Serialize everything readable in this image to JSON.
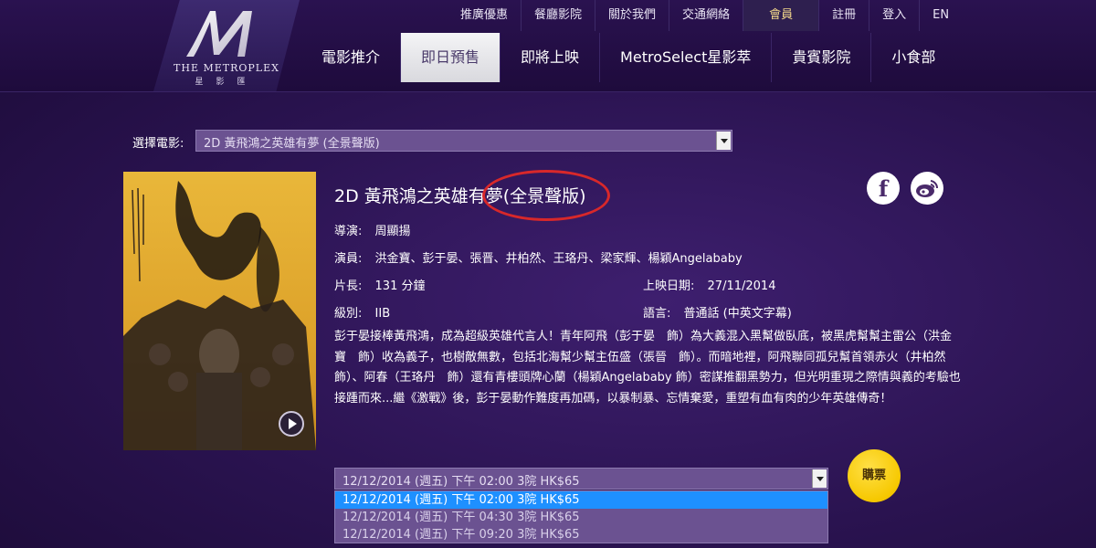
{
  "brand": {
    "name": "THE METROPLEX",
    "chinese": "星影匯"
  },
  "top_nav": [
    "推廣優惠",
    "餐廳影院",
    "關於我們",
    "交通網絡",
    "會員",
    "註冊",
    "登入",
    "EN"
  ],
  "main_nav": [
    "電影推介",
    "即日預售",
    "即將上映",
    "MetroSelect星影萃",
    "貴賓影院",
    "小食部"
  ],
  "active_tab": "即日預售",
  "movie_select": {
    "label": "選擇電影:",
    "value": "2D 黃飛鴻之英雄有夢 (全景聲版)"
  },
  "movie": {
    "title": "2D 黃飛鴻之英雄有夢(全景聲版)",
    "director_label": "導演:",
    "director": "周顯揚",
    "cast_label": "演員:",
    "cast": "洪金寶、彭于晏、張晋、井柏然、王珞丹、梁家輝、楊穎Angelababy",
    "duration_label": "片長:",
    "duration": "131 分鐘",
    "release_label": "上映日期:",
    "release": "27/11/2014",
    "rating_label": "級別:",
    "rating": "IIB",
    "language_label": "語言:",
    "language": "普通話 (中英文字幕)",
    "synopsis": "彭于晏接棒黃飛鴻，成為超級英雄代言人！青年阿飛（彭于晏　飾）為大義混入黑幫做臥底，被黑虎幫幫主雷公（洪金寶　飾）收為義子，也樹敵無數，包括北海幫少幫主伍盛（張晉　飾）。而暗地裡，阿飛聯同孤兒幫首領赤火（井柏然　飾）、阿春（王珞丹　飾）還有青樓頭牌心蘭（楊穎Angelababy 飾）密謀推翻黑勢力，但光明重現之際情與義的考驗也接踵而來...繼《激戰》後，彭于晏動作難度再加碼，以暴制暴、忘情棄愛，重塑有血有肉的少年英雄傳奇！"
  },
  "showtime_select": {
    "value": "12/12/2014 (週五) 下午 02:00 3院 HK$65",
    "options": [
      "12/12/2014 (週五) 下午 02:00 3院 HK$65",
      "12/12/2014 (週五) 下午 04:30 3院 HK$65",
      "12/12/2014 (週五) 下午 09:20 3院 HK$65"
    ]
  },
  "buy_label": "購票",
  "colors": {
    "accent_red": "#d8282a",
    "buy_yellow": "#f6c800",
    "select_bg": "#6b5291",
    "highlight": "#1e90ff"
  },
  "icons": {
    "facebook": "facebook-icon",
    "weibo": "weibo-icon",
    "play": "play-icon"
  }
}
